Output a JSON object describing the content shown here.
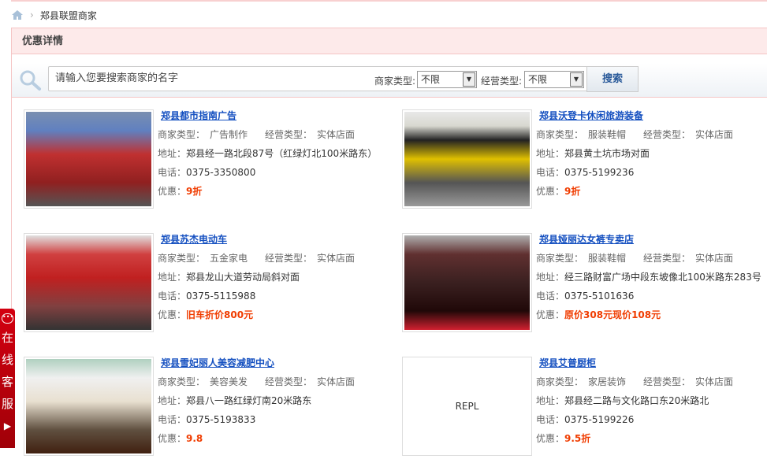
{
  "breadcrumb": {
    "current": "郑县联盟商家"
  },
  "section_title": "优惠详情",
  "search": {
    "placeholder": "请输入您要搜索商家的名字",
    "merchant_type_label": "商家类型:",
    "merchant_type_value": "不限",
    "business_type_label": "经营类型:",
    "business_type_value": "不限",
    "button": "搜索"
  },
  "labels": {
    "merchant_type": "商家类型：",
    "business_type": "经营类型：",
    "address": "地址：",
    "phone": "电话：",
    "discount": "优惠："
  },
  "merchants": [
    {
      "name": "郑县都市指南广告",
      "merchant_type": "广告制作",
      "business_type": "实体店面",
      "address": "郑县经一路北段87号（红绿灯北100米路东）",
      "phone": "0375-3350800",
      "discount": "9折"
    },
    {
      "name": "郑县沃登卡休闲旅游装备",
      "merchant_type": "服装鞋帽",
      "business_type": "实体店面",
      "address": "郑县黄土坑市场对面",
      "phone": "0375-5199236",
      "discount": "9折"
    },
    {
      "name": "郑县苏杰电动车",
      "merchant_type": "五金家电",
      "business_type": "实体店面",
      "address": "郑县龙山大道劳动局斜对面",
      "phone": "0375-5115988",
      "discount": "旧车折价800元"
    },
    {
      "name": "郑县娅丽达女裤专卖店",
      "merchant_type": "服装鞋帽",
      "business_type": "实体店面",
      "address": "经三路财富广场中段东坡像北100米路东283号",
      "phone": "0375-5101636",
      "discount": "原价308元现价108元"
    },
    {
      "name": "郑县雪妃丽人美容减肥中心",
      "merchant_type": "美容美发",
      "business_type": "实体店面",
      "address": "郑县八一路红绿灯南20米路东",
      "phone": "0375-5193833",
      "discount": "9.8"
    },
    {
      "name": "郑县艾普厨柜",
      "merchant_type": "家居装饰",
      "business_type": "实体店面",
      "address": "郑县经二路与文化路口东20米路北",
      "phone": "0375-5199226",
      "discount": "9.5折"
    }
  ],
  "kefu": {
    "text": "在线客服"
  }
}
